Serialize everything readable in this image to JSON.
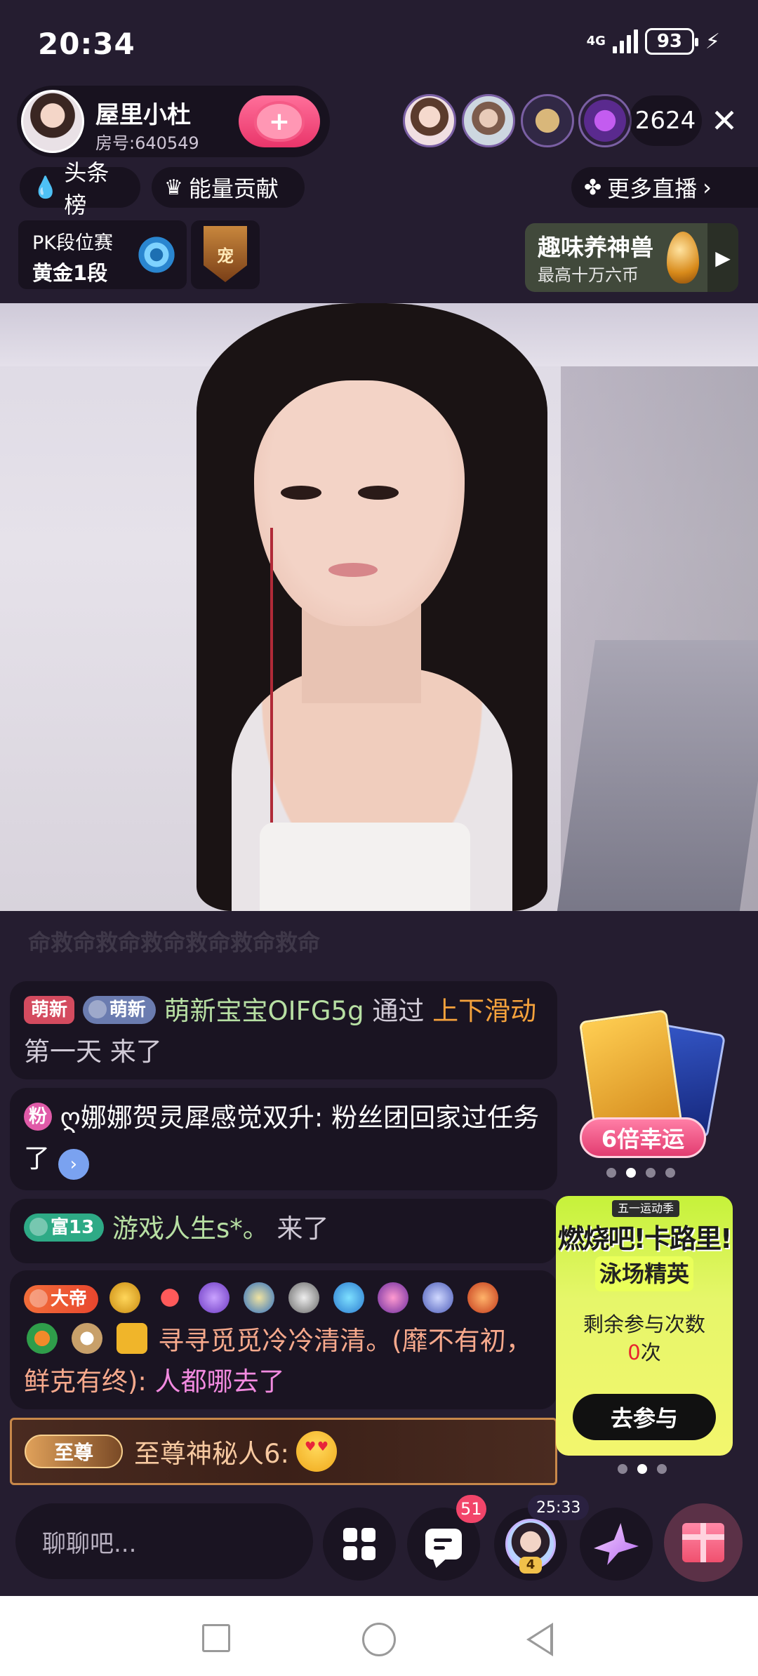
{
  "status_bar": {
    "time": "20:34",
    "network": "4G",
    "battery": "93"
  },
  "host": {
    "name": "屋里小杜",
    "room": "房号:640549"
  },
  "viewers": {
    "count": "2624"
  },
  "chips": {
    "headline": "头条榜",
    "energy": "能量贡献",
    "more_live": "更多直播"
  },
  "pk": {
    "title": "PK段位赛",
    "rank": "黄金1段",
    "badge_text": "宠"
  },
  "promo": {
    "title": "趣味养神兽",
    "subtitle": "最高十万六币"
  },
  "ghost_text": "命救命救命救命救命救命救命",
  "chat": {
    "msg1": {
      "tag_new": "萌新",
      "tag_level": "萌新",
      "user": "萌新宝宝OIFG5g",
      "via": "通过",
      "method": "上下滑动",
      "text": "第一天 来了"
    },
    "msg2": {
      "fan_tag": "粉",
      "text": "ღ娜娜贺灵犀感觉双升: 粉丝团回家过任务了"
    },
    "msg3": {
      "tag": "富13",
      "user": "游戏人生s*。",
      "text": "来了"
    },
    "msg4": {
      "tag": "大帝",
      "user": "寻寻觅觅冷冷清清。(靡不有初，鲜克有终):",
      "text": "人都哪去了"
    },
    "msg5": {
      "tag": "至尊",
      "text": "至尊神秘人6:"
    }
  },
  "side": {
    "lucky_label": "6倍幸运",
    "event_season": "五一运动季",
    "event_title": "燃烧吧!卡路里!",
    "event_subtitle": "泳场精英",
    "event_remaining_label": "剩余参与次数",
    "event_remaining_count": "0",
    "event_remaining_unit": "次",
    "event_join": "去参与"
  },
  "bottom": {
    "input_placeholder": "聊聊吧...",
    "message_badge": "51",
    "timer": "25:33",
    "avatar_level": "4"
  }
}
